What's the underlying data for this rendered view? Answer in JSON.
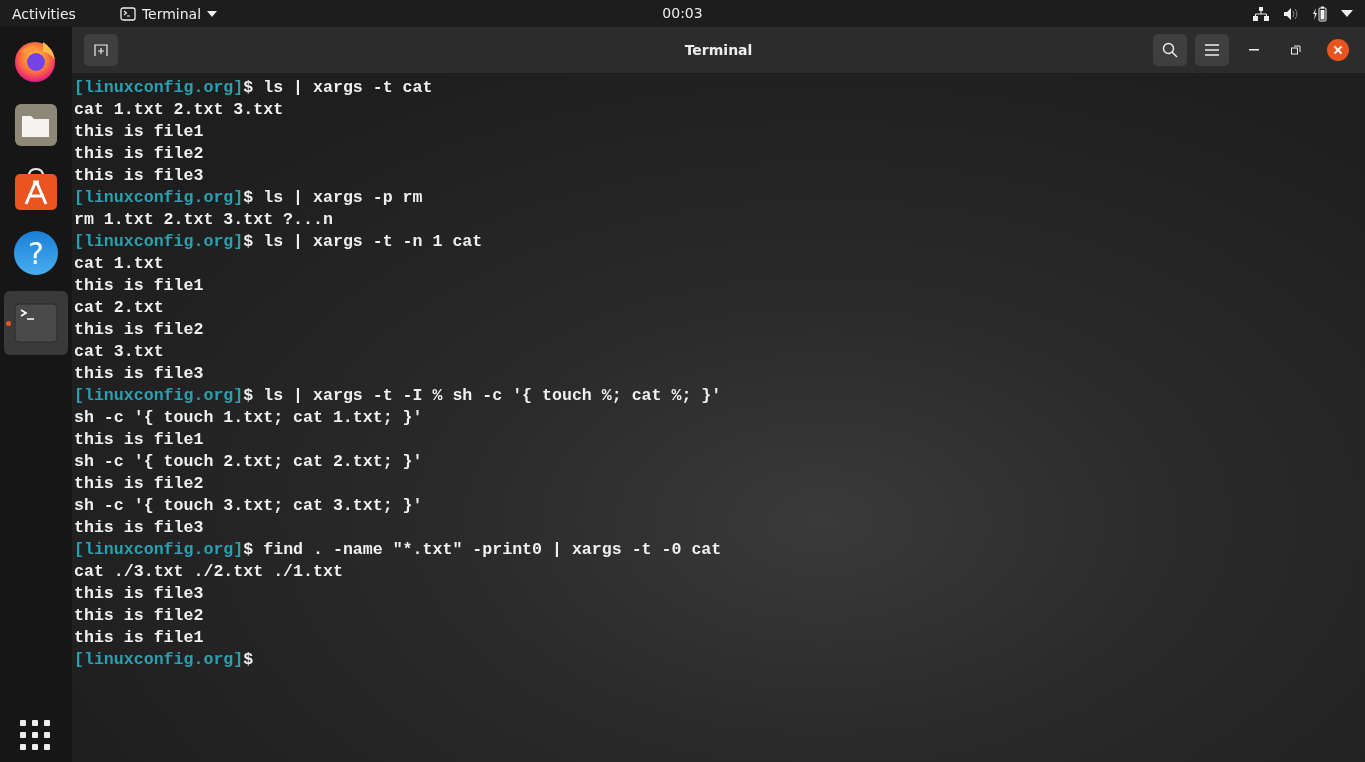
{
  "top_bar": {
    "activities": "Activities",
    "app_menu": "Terminal",
    "clock": "00:03"
  },
  "dock": {
    "items": [
      {
        "kind": "firefox",
        "running": false,
        "selected": false
      },
      {
        "kind": "files",
        "running": false,
        "selected": false
      },
      {
        "kind": "software",
        "running": false,
        "selected": false
      },
      {
        "kind": "help",
        "glyph": "?",
        "running": false,
        "selected": false
      },
      {
        "kind": "terminal",
        "running": true,
        "selected": true
      }
    ]
  },
  "window": {
    "title": "Terminal",
    "lines": [
      {
        "kind": "prompt",
        "prompt": "[linuxconfig.org]",
        "text": "$ ls | xargs -t cat"
      },
      {
        "kind": "output",
        "text": "cat 1.txt 2.txt 3.txt"
      },
      {
        "kind": "output",
        "text": "this is file1"
      },
      {
        "kind": "output",
        "text": "this is file2"
      },
      {
        "kind": "output",
        "text": "this is file3"
      },
      {
        "kind": "prompt",
        "prompt": "[linuxconfig.org]",
        "text": "$ ls | xargs -p rm"
      },
      {
        "kind": "output",
        "text": "rm 1.txt 2.txt 3.txt ?...n"
      },
      {
        "kind": "prompt",
        "prompt": "[linuxconfig.org]",
        "text": "$ ls | xargs -t -n 1 cat"
      },
      {
        "kind": "output",
        "text": "cat 1.txt"
      },
      {
        "kind": "output",
        "text": "this is file1"
      },
      {
        "kind": "output",
        "text": "cat 2.txt"
      },
      {
        "kind": "output",
        "text": "this is file2"
      },
      {
        "kind": "output",
        "text": "cat 3.txt"
      },
      {
        "kind": "output",
        "text": "this is file3"
      },
      {
        "kind": "prompt",
        "prompt": "[linuxconfig.org]",
        "text": "$ ls | xargs -t -I % sh -c '{ touch %; cat %; }'"
      },
      {
        "kind": "output",
        "text": "sh -c '{ touch 1.txt; cat 1.txt; }'"
      },
      {
        "kind": "output",
        "text": "this is file1"
      },
      {
        "kind": "output",
        "text": "sh -c '{ touch 2.txt; cat 2.txt; }'"
      },
      {
        "kind": "output",
        "text": "this is file2"
      },
      {
        "kind": "output",
        "text": "sh -c '{ touch 3.txt; cat 3.txt; }'"
      },
      {
        "kind": "output",
        "text": "this is file3"
      },
      {
        "kind": "prompt",
        "prompt": "[linuxconfig.org]",
        "text": "$ find . -name \"*.txt\" -print0 | xargs -t -0 cat"
      },
      {
        "kind": "output",
        "text": "cat ./3.txt ./2.txt ./1.txt"
      },
      {
        "kind": "output",
        "text": "this is file3"
      },
      {
        "kind": "output",
        "text": "this is file2"
      },
      {
        "kind": "output",
        "text": "this is file1"
      },
      {
        "kind": "prompt",
        "prompt": "[linuxconfig.org]",
        "text": "$"
      }
    ]
  }
}
